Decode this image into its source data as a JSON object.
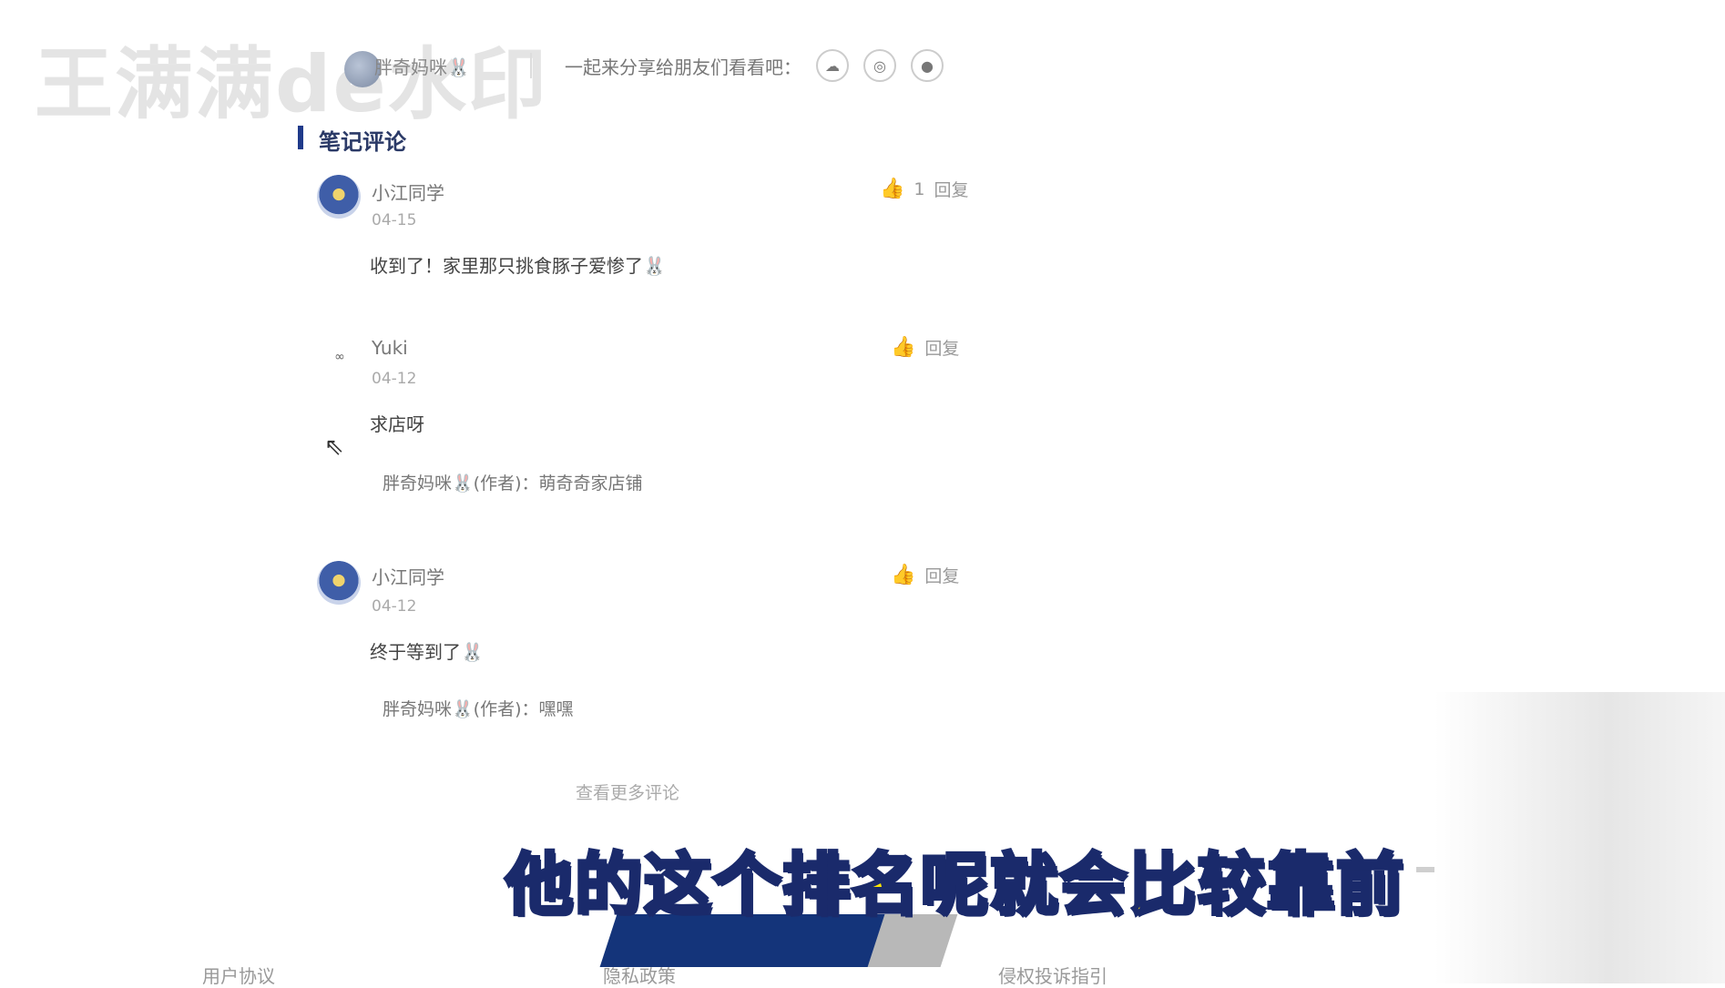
{
  "watermark": "王满满de水印",
  "author": {
    "name": "胖奇妈咪🐰"
  },
  "share": {
    "text": "一起来分享给朋友们看看吧：",
    "icons": [
      "cloud-icon",
      "weibo-icon",
      "qq-icon"
    ]
  },
  "section": {
    "title": "笔记评论"
  },
  "comments": [
    {
      "user": "小江同学",
      "date": "04-15",
      "text": "收到了！家里那只挑食豚子爱惨了🐰",
      "likes": "1",
      "reply_label": "回复"
    },
    {
      "user": "Yuki",
      "date": "04-12",
      "text": "求店呀",
      "likes": "",
      "reply_label": "回复",
      "reply": "胖奇妈咪🐰(作者)：萌奇奇家店铺"
    },
    {
      "user": "小江同学",
      "date": "04-12",
      "text": "终于等到了🐰",
      "likes": "",
      "reply_label": "回复",
      "reply": "胖奇妈咪🐰(作者)：嘿嘿"
    }
  ],
  "more_comments": "查看更多评论",
  "subtitle": "他的这个排名呢就会比较靠前",
  "footer": {
    "links": [
      "用户协议",
      "隐私政策",
      "侵权投诉指引"
    ]
  },
  "icons": {
    "like": "thumbs-up-icon",
    "cursor": "mouse-pointer-icon"
  },
  "colors": {
    "accent": "#1f3a8a",
    "subtitle_fill": "#ffe600",
    "subtitle_stroke": "#1a2a6b"
  }
}
